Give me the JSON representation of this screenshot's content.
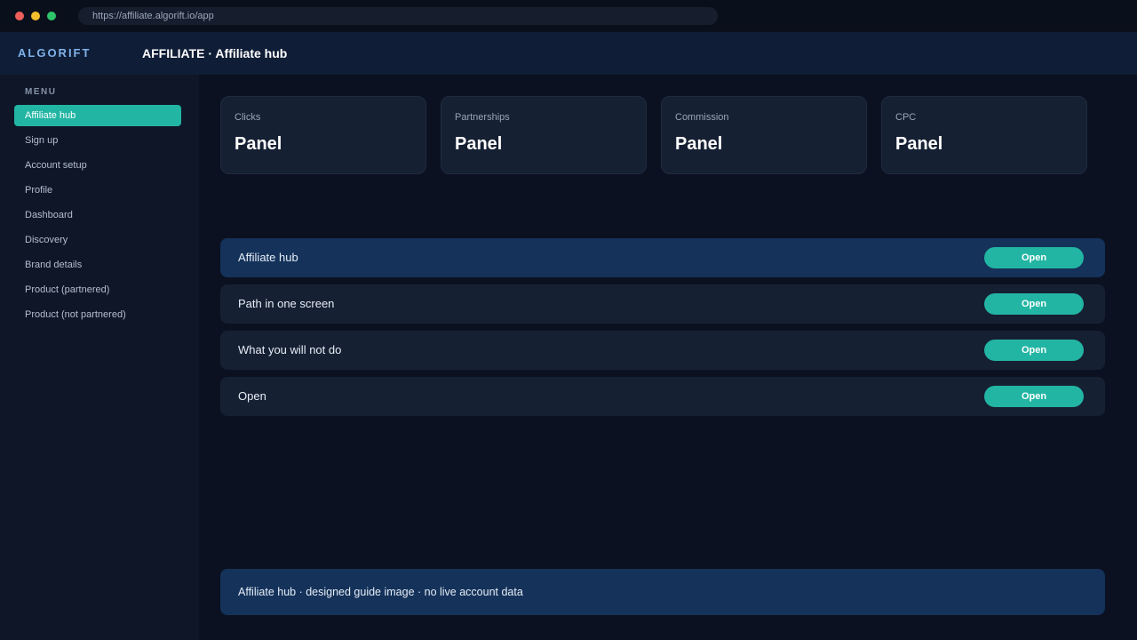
{
  "browser": {
    "url": "https://affiliate.algorift.io/app"
  },
  "header": {
    "brand": "ALGORIFT",
    "title": "AFFILIATE · Affiliate hub"
  },
  "sidebar": {
    "heading": "MENU",
    "items": [
      {
        "label": "Affiliate hub",
        "active": true
      },
      {
        "label": "Sign up"
      },
      {
        "label": "Account setup"
      },
      {
        "label": "Profile"
      },
      {
        "label": "Dashboard"
      },
      {
        "label": "Discovery"
      },
      {
        "label": "Brand details"
      },
      {
        "label": "Product (partnered)"
      },
      {
        "label": "Product (not partnered)"
      }
    ]
  },
  "cards": [
    {
      "label": "Clicks",
      "value": "Panel"
    },
    {
      "label": "Partnerships",
      "value": "Panel"
    },
    {
      "label": "Commission",
      "value": "Panel"
    },
    {
      "label": "CPC",
      "value": "Panel"
    }
  ],
  "rows": [
    {
      "label": "Affiliate hub",
      "button": "Open",
      "highlight": true
    },
    {
      "label": "Path in one screen",
      "button": "Open"
    },
    {
      "label": "What you will not do",
      "button": "Open"
    },
    {
      "label": "Open",
      "button": "Open"
    }
  ],
  "footer": {
    "note": "Affiliate hub · designed guide image · no live account data"
  },
  "colors": {
    "accent": "#22b5a3",
    "topbar": "#0f1d36",
    "highlight_row": "#14325a",
    "background": "#0b1120"
  }
}
